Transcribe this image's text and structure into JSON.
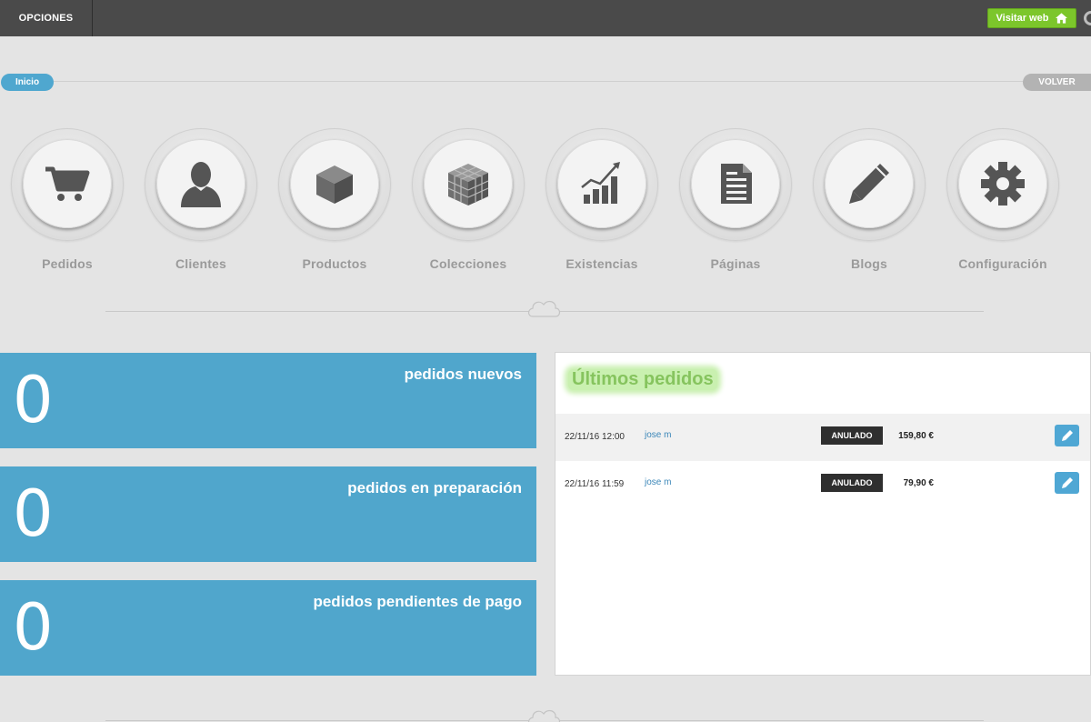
{
  "topbar": {
    "menu_label": "OPCIONES",
    "visit_label": "Visitar web",
    "visit_icon": "home-icon"
  },
  "breadcrumb": {
    "home_label": "Inicio",
    "back_label": "VOLVER"
  },
  "nav": {
    "items": [
      {
        "label": "Pedidos",
        "icon": "cart-icon"
      },
      {
        "label": "Clientes",
        "icon": "user-icon"
      },
      {
        "label": "Productos",
        "icon": "cube-icon"
      },
      {
        "label": "Colecciones",
        "icon": "cubes-icon"
      },
      {
        "label": "Existencias",
        "icon": "chart-icon"
      },
      {
        "label": "Páginas",
        "icon": "document-icon"
      },
      {
        "label": "Blogs",
        "icon": "pencil-icon"
      },
      {
        "label": "Configuración",
        "icon": "gear-icon"
      }
    ]
  },
  "stats": [
    {
      "value": "0",
      "label": "pedidos nuevos"
    },
    {
      "value": "0",
      "label": "pedidos en preparación"
    },
    {
      "value": "0",
      "label": "pedidos pendientes de pago"
    }
  ],
  "orders": {
    "title": "Últimos pedidos",
    "rows": [
      {
        "date": "22/11/16 12:00",
        "customer": "jose m",
        "status": "ANULADO",
        "total": "159,80 €"
      },
      {
        "date": "22/11/16 11:59",
        "customer": "jose m",
        "status": "ANULADO",
        "total": "79,90 €"
      }
    ]
  },
  "colors": {
    "accent_blue": "#50a6cc",
    "green_button": "#7cc62b",
    "topbar": "#4a4a4a",
    "status_badge": "#2f2f2f"
  }
}
